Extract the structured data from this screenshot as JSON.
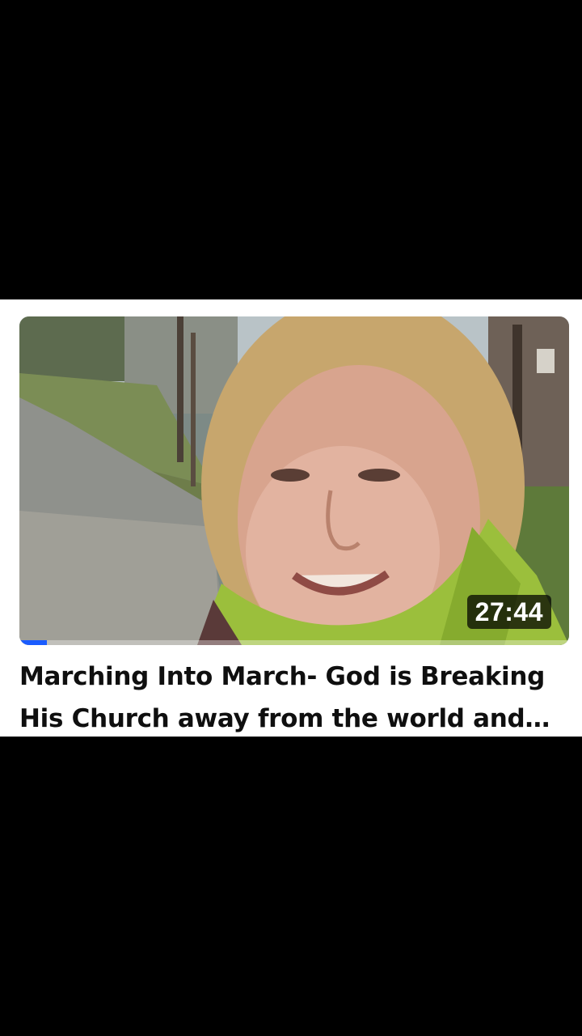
{
  "video": {
    "title": "Marching Into March- God is Breaking His Church away from the world and…",
    "duration": "27:44",
    "watch_progress_percent": 5,
    "thumbnail_subject": "selfie-video-outdoors-woman-smiling"
  },
  "colors": {
    "background": "#000000",
    "card": "#ffffff",
    "title_text": "#0f0f0f",
    "progress": "#1a5cff",
    "duration_badge": "#000000"
  }
}
